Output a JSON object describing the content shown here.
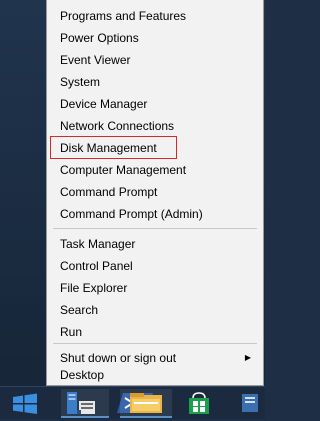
{
  "menu": {
    "items": [
      {
        "label": "Programs and Features"
      },
      {
        "label": "Power Options"
      },
      {
        "label": "Event Viewer"
      },
      {
        "label": "System"
      },
      {
        "label": "Device Manager"
      },
      {
        "label": "Network Connections"
      },
      {
        "label": "Disk Management",
        "highlighted": true
      },
      {
        "label": "Computer Management"
      },
      {
        "label": "Command Prompt"
      },
      {
        "label": "Command Prompt (Admin)"
      },
      {
        "label": "Task Manager"
      },
      {
        "label": "Control Panel"
      },
      {
        "label": "File Explorer"
      },
      {
        "label": "Search"
      },
      {
        "label": "Run"
      },
      {
        "label": "Shut down or sign out",
        "has_submenu": true
      },
      {
        "label": "Desktop"
      }
    ]
  },
  "taskbar": {
    "icons": [
      "windows-start-icon",
      "server-manager-icon",
      "powershell-icon",
      "file-explorer-icon",
      "windows-store-icon"
    ]
  },
  "colors": {
    "highlight_border": "#d42a2a",
    "menu_background": "#f2f2f2",
    "taskbar_background": "#1b2a3f"
  }
}
